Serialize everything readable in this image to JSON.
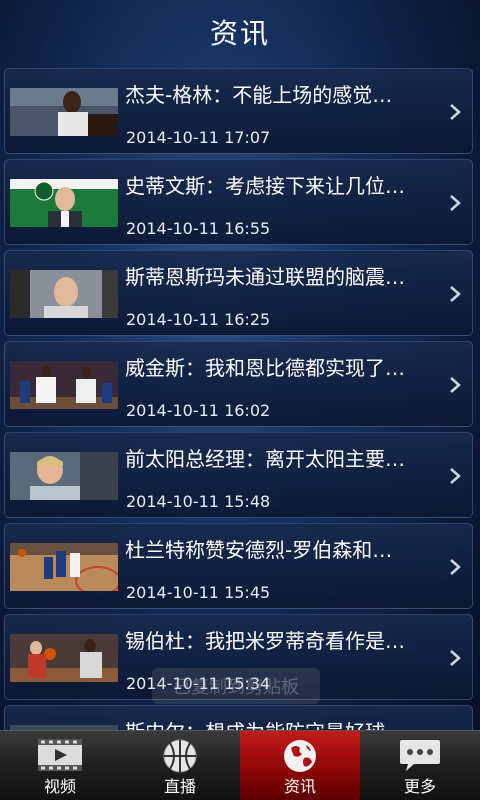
{
  "header": {
    "title": "资讯"
  },
  "news": [
    {
      "title": "杰夫-格林：不能上场的感觉…",
      "time": "2014-10-11 17:07"
    },
    {
      "title": "史蒂文斯：考虑接下来让几位…",
      "time": "2014-10-11 16:55"
    },
    {
      "title": "斯蒂恩斯玛未通过联盟的脑震…",
      "time": "2014-10-11 16:25"
    },
    {
      "title": "威金斯：我和恩比德都实现了…",
      "time": "2014-10-11 16:02"
    },
    {
      "title": "前太阳总经理：离开太阳主要…",
      "time": "2014-10-11 15:48"
    },
    {
      "title": "杜兰特称赞安德烈-罗伯森和…",
      "time": "2014-10-11 15:45"
    },
    {
      "title": "锡伯杜：我把米罗蒂奇看作是…",
      "time": "2014-10-11 15:34"
    },
    {
      "title": "斯内尔：想成为能防守最好球…",
      "time": ""
    }
  ],
  "toast": "已复制到剪贴板",
  "tabs": [
    {
      "label": "视频",
      "icon": "film-icon",
      "active": false
    },
    {
      "label": "直播",
      "icon": "basketball-icon",
      "active": false
    },
    {
      "label": "资讯",
      "icon": "globe-icon",
      "active": true
    },
    {
      "label": "更多",
      "icon": "chat-bubble-icon",
      "active": false
    }
  ],
  "colors": {
    "active_tab": "#b01010",
    "background": "#0b1a38"
  }
}
